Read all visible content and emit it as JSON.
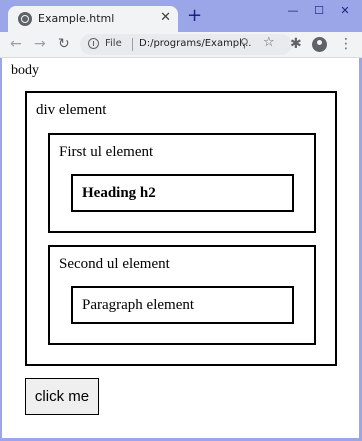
{
  "browser": {
    "tab": {
      "title": "Example.html",
      "close_glyph": "✕"
    },
    "new_tab_glyph": "+",
    "window_controls": {
      "minimize": "—",
      "maximize": "☐",
      "close": "✕"
    },
    "toolbar": {
      "back_glyph": "←",
      "forward_glyph": "→",
      "reload_glyph": "↻",
      "omnibox": {
        "scheme_label": "File",
        "url": "D:/programs/Exampl..."
      },
      "zoom_glyph": "⚲",
      "star_glyph": "☆",
      "extensions_glyph": "✱",
      "menu_glyph": "⋮"
    }
  },
  "page": {
    "body_label": "body",
    "div_label": "div element",
    "ul1": {
      "label": "First ul element",
      "child_text": "Heading h2"
    },
    "ul2": {
      "label": "Second ul element",
      "child_text": "Paragraph element"
    },
    "button_label": "click me"
  },
  "colors": {
    "frame": "#9aa6e8",
    "toolbar": "#f1f3f4",
    "omnibox": "#e8eaed",
    "button_bg": "#efefef"
  }
}
